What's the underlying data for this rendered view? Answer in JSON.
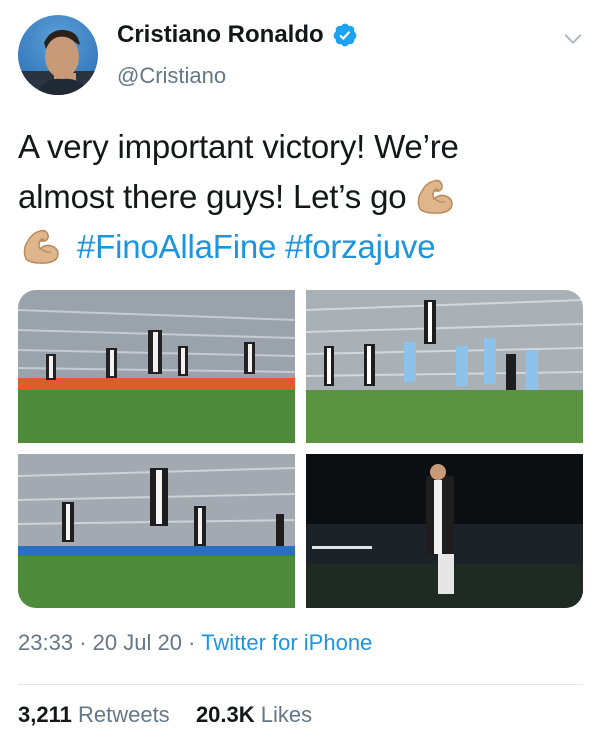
{
  "tweet": {
    "author_name": "Cristiano Ronaldo",
    "author_handle": "@Cristiano",
    "verified_icon": "verified-badge-icon",
    "menu_icon": "chevron-down-icon",
    "text_line1": "A very important victory! We’re",
    "text_line2_before_emoji": "almost there guys! Let’s go",
    "emoji": "flexed-biceps",
    "hashtags": [
      "#FinoAllaFine",
      "#forzajuve"
    ],
    "photos": [
      {
        "name": "photo-celebration-team"
      },
      {
        "name": "photo-header-corner"
      },
      {
        "name": "photo-celebration-ronaldo"
      },
      {
        "name": "photo-ronaldo-night"
      }
    ],
    "time": "23:33",
    "date": "20 Jul 20",
    "separator": "·",
    "source": "Twitter for iPhone",
    "retweets_count": "3,211",
    "retweets_label": "Retweets",
    "likes_count": "20.3K",
    "likes_label": "Likes"
  },
  "colors": {
    "link": "#1b95e0",
    "text": "#14171a",
    "secondary": "#657786",
    "divider": "#e1e8ed"
  }
}
